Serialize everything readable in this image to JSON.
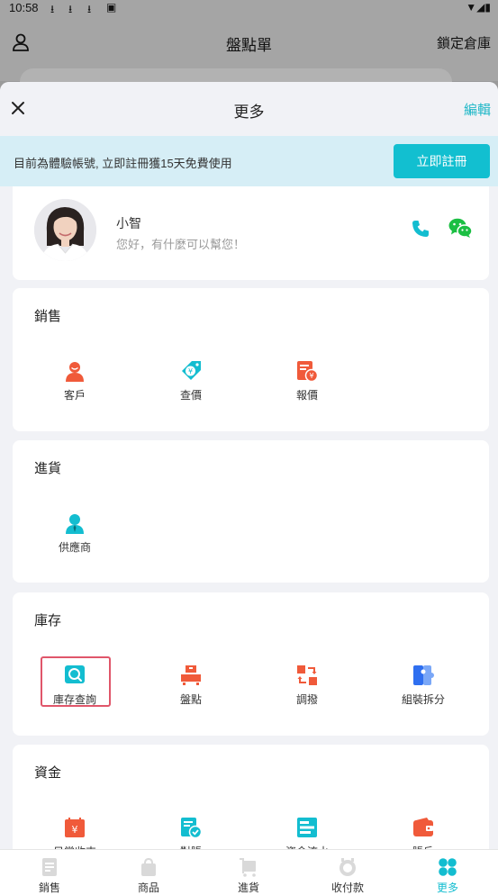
{
  "status_bar": {
    "time": "10:58"
  },
  "background_page": {
    "title": "盤點單",
    "right_link": "鎖定倉庫"
  },
  "sheet": {
    "title": "更多",
    "edit_label": "編輯"
  },
  "banner": {
    "message": "目前為體驗帳號, 立即註冊獲15天免費使用",
    "button_label": "立即註冊"
  },
  "assistant": {
    "name": "小智",
    "greeting": "您好，有什麼可以幫您！"
  },
  "sections": [
    {
      "title": "銷售",
      "items": [
        {
          "label": "客戶",
          "icon": "customer-icon"
        },
        {
          "label": "查價",
          "icon": "price-tag-icon"
        },
        {
          "label": "報價",
          "icon": "quote-icon"
        }
      ]
    },
    {
      "title": "進貨",
      "items": [
        {
          "label": "供應商",
          "icon": "supplier-icon"
        }
      ]
    },
    {
      "title": "庫存",
      "items": [
        {
          "label": "庫存查詢",
          "icon": "inventory-search-icon"
        },
        {
          "label": "盤點",
          "icon": "stocktake-icon"
        },
        {
          "label": "調撥",
          "icon": "transfer-icon"
        },
        {
          "label": "組裝拆分",
          "icon": "assemble-icon"
        }
      ]
    },
    {
      "title": "資金",
      "items": [
        {
          "label": "日常收支",
          "icon": "daily-finance-icon"
        },
        {
          "label": "對賬",
          "icon": "reconcile-icon"
        },
        {
          "label": "資金流水",
          "icon": "cash-flow-icon"
        },
        {
          "label": "賬戶",
          "icon": "wallet-icon"
        }
      ]
    }
  ],
  "tabbar": [
    {
      "label": "銷售",
      "icon": "sales-doc-icon"
    },
    {
      "label": "商品",
      "icon": "bag-icon"
    },
    {
      "label": "進貨",
      "icon": "cart-icon"
    },
    {
      "label": "收付款",
      "icon": "payment-icon"
    },
    {
      "label": "更多",
      "icon": "more-grid-icon",
      "active": true
    }
  ],
  "colors": {
    "accent": "#12bfd0",
    "orange": "#f05a3a",
    "highlight": "#e0566a"
  }
}
